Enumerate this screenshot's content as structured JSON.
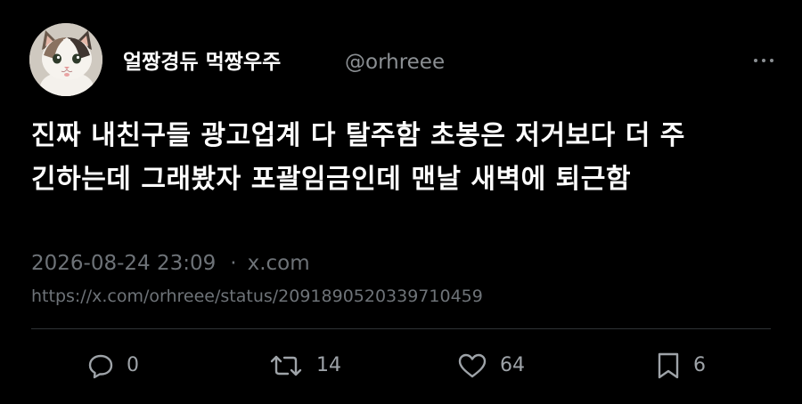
{
  "tweet": {
    "display_name": "얼짱경듀 먹짱우주",
    "handle": "@orhreee",
    "text_line1": "진짜 내친구들 광고업계 다 탈주함 초봉은 저거보다 더 주",
    "text_line2": "긴하는데 그래봤자 포괄임금인데 맨날 새벽에 퇴근함",
    "timestamp": "2026-08-24 23:09",
    "separator": "·",
    "source": "x.com",
    "url": "https://x.com/orhreee/status/2091890520339710459"
  },
  "actions": {
    "replies": "0",
    "reposts": "14",
    "likes": "64",
    "bookmarks": "6"
  },
  "icons": {
    "avatar": "cat-avatar",
    "more": "more-icon",
    "reply": "reply-icon",
    "repost": "repost-icon",
    "like": "heart-icon",
    "bookmark": "bookmark-icon"
  },
  "colors": {
    "background": "#000000",
    "text": "#ffffff",
    "muted": "#6e7378",
    "divider": "#2f3336"
  }
}
